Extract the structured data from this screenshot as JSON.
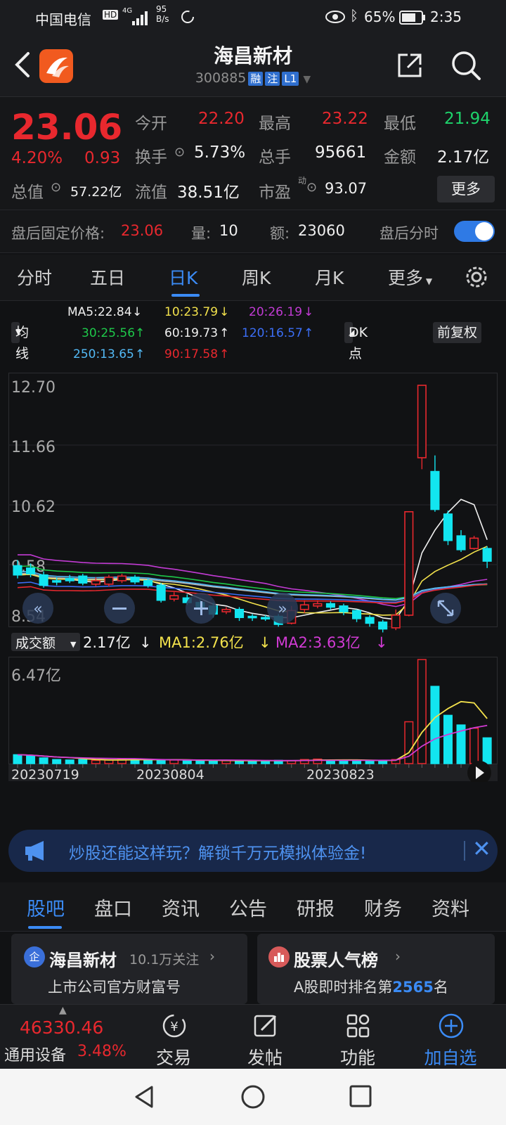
{
  "status": {
    "carrier": "中国电信",
    "network": "4G",
    "speed_value": "95",
    "speed_unit": "B/s",
    "battery": "65%",
    "time": "2:35"
  },
  "header": {
    "title": "海昌新材",
    "code": "300885",
    "tags": [
      "融",
      "注",
      "L1"
    ]
  },
  "quote": {
    "price": "23.06",
    "change_pct": "4.20%",
    "change_amt": "0.93",
    "open_label": "今开",
    "open": "22.20",
    "high_label": "最高",
    "high": "23.22",
    "low_label": "最低",
    "low": "21.94",
    "turnover_label": "换手",
    "turnover": "5.73%",
    "volume_label": "总手",
    "volume": "95661",
    "amount_label": "金额",
    "amount": "2.17亿",
    "mcap_label": "总值",
    "mcap": "57.22亿",
    "float_label": "流值",
    "float": "38.51亿",
    "pe_label": "市盈",
    "pe_sup": "动",
    "pe": "93.07",
    "more_label": "更多",
    "after_label": "盘后固定价格:",
    "after_price": "23.06",
    "after_vol_label": "量:",
    "after_vol": "10",
    "after_amt_label": "额:",
    "after_amt": "23060",
    "after_time_label": "盘后分时"
  },
  "ktabs": [
    "分时",
    "五日",
    "日K",
    "周K",
    "月K",
    "更多"
  ],
  "ma": {
    "ma5": "MA5:22.84",
    "ma10": "10:23.79",
    "ma20": "20:26.19",
    "ma30": "30:25.56",
    "ma60": "60:19.73",
    "ma120": "120:16.57",
    "ma250": "250:13.65",
    "ma90": "90:17.58",
    "avg_btn": "均线",
    "dk_btn": "DK点",
    "adj_btn": "前复权",
    "colors": {
      "ma5": "#f0f0f0",
      "ma10": "#f3e24c",
      "ma20": "#c23bd4",
      "ma30": "#1ec84a",
      "ma60": "#f0f0f0",
      "ma120": "#3b6ef5",
      "ma250": "#53b9f5",
      "ma90": "#e8282e"
    }
  },
  "vol": {
    "label": "成交额",
    "value": "2.17亿",
    "ma1": "MA1:2.76亿",
    "ma2": "MA2:3.63亿",
    "max": "6.47亿"
  },
  "chart_data": {
    "type": "candlestick",
    "y_ticks": [
      "12.70",
      "11.66",
      "10.62",
      "9.58",
      "8.54"
    ],
    "ylim": [
      8.54,
      12.7
    ],
    "x_ticks": [
      "20230719",
      "20230804",
      "20230823"
    ],
    "candles": [
      {
        "o": 9.56,
        "c": 9.4,
        "h": 9.66,
        "l": 9.34
      },
      {
        "o": 9.52,
        "c": 9.42,
        "h": 9.6,
        "l": 9.36
      },
      {
        "o": 9.4,
        "c": 9.22,
        "h": 9.46,
        "l": 9.18
      },
      {
        "o": 9.3,
        "c": 9.28,
        "h": 9.36,
        "l": 9.22
      },
      {
        "o": 9.34,
        "c": 9.3,
        "h": 9.4,
        "l": 9.26
      },
      {
        "o": 9.38,
        "c": 9.26,
        "h": 9.42,
        "l": 9.22
      },
      {
        "o": 9.24,
        "c": 9.3,
        "h": 9.36,
        "l": 9.2
      },
      {
        "o": 9.24,
        "c": 9.36,
        "h": 9.4,
        "l": 9.2
      },
      {
        "o": 9.3,
        "c": 9.38,
        "h": 9.42,
        "l": 9.26
      },
      {
        "o": 9.36,
        "c": 9.28,
        "h": 9.4,
        "l": 9.24
      },
      {
        "o": 9.3,
        "c": 9.22,
        "h": 9.34,
        "l": 9.18
      },
      {
        "o": 9.22,
        "c": 8.96,
        "h": 9.26,
        "l": 8.92
      },
      {
        "o": 8.98,
        "c": 9.04,
        "h": 9.1,
        "l": 8.94
      },
      {
        "o": 9.0,
        "c": 8.92,
        "h": 9.06,
        "l": 8.88
      },
      {
        "o": 8.92,
        "c": 8.82,
        "h": 8.98,
        "l": 8.78
      },
      {
        "o": 8.86,
        "c": 8.72,
        "h": 8.92,
        "l": 8.66
      },
      {
        "o": 8.76,
        "c": 8.8,
        "h": 8.84,
        "l": 8.72
      },
      {
        "o": 8.8,
        "c": 8.66,
        "h": 8.84,
        "l": 8.6
      },
      {
        "o": 8.68,
        "c": 8.66,
        "h": 8.72,
        "l": 8.6
      },
      {
        "o": 8.66,
        "c": 8.64,
        "h": 8.7,
        "l": 8.6
      },
      {
        "o": 8.68,
        "c": 8.54,
        "h": 8.72,
        "l": 8.5
      },
      {
        "o": 8.56,
        "c": 8.78,
        "h": 8.86,
        "l": 8.54
      },
      {
        "o": 8.8,
        "c": 8.88,
        "h": 8.96,
        "l": 8.74
      },
      {
        "o": 8.86,
        "c": 8.9,
        "h": 8.96,
        "l": 8.82
      },
      {
        "o": 8.9,
        "c": 8.84,
        "h": 8.94,
        "l": 8.8
      },
      {
        "o": 8.86,
        "c": 8.76,
        "h": 8.9,
        "l": 8.7
      },
      {
        "o": 8.78,
        "c": 8.64,
        "h": 8.8,
        "l": 8.58
      },
      {
        "o": 8.66,
        "c": 8.56,
        "h": 8.7,
        "l": 8.5
      },
      {
        "o": 8.58,
        "c": 8.46,
        "h": 8.62,
        "l": 8.4
      },
      {
        "o": 8.48,
        "c": 8.7,
        "h": 8.8,
        "l": 8.44
      },
      {
        "o": 8.7,
        "c": 10.5,
        "h": 10.5,
        "l": 8.68
      },
      {
        "o": 11.44,
        "c": 12.7,
        "h": 12.7,
        "l": 11.24
      },
      {
        "o": 11.2,
        "c": 10.54,
        "h": 11.48,
        "l": 10.5
      },
      {
        "o": 10.46,
        "c": 10.0,
        "h": 10.52,
        "l": 9.92
      },
      {
        "o": 10.08,
        "c": 9.84,
        "h": 10.18,
        "l": 9.8
      },
      {
        "o": 9.86,
        "c": 10.04,
        "h": 10.08,
        "l": 9.84
      },
      {
        "o": 9.86,
        "c": 9.64,
        "h": 9.9,
        "l": 9.52
      }
    ],
    "volumes": [
      0.55,
      0.5,
      0.35,
      0.25,
      0.22,
      0.25,
      0.2,
      0.22,
      0.25,
      0.28,
      0.25,
      0.2,
      0.22,
      0.2,
      0.18,
      0.2,
      0.18,
      0.18,
      0.16,
      0.18,
      0.2,
      0.18,
      0.25,
      0.28,
      0.2,
      0.22,
      0.18,
      0.18,
      0.2,
      0.25,
      2.6,
      6.47,
      4.8,
      3.0,
      2.4,
      2.2,
      1.6
    ]
  },
  "banner": {
    "text": "炒股还能这样玩？解锁千万元模拟体验金!"
  },
  "ltabs": [
    "股吧",
    "盘口",
    "资讯",
    "公告",
    "研报",
    "财务",
    "资料"
  ],
  "cards": {
    "left_title": "海昌新材",
    "left_follow": "10.1万关注",
    "left_sub": "上市公司官方财富号",
    "right_title": "股票人气榜",
    "right_sub_pre": "A股即时排名第",
    "right_rank": "2565",
    "right_sub_post": "名"
  },
  "bottom": {
    "index_value": "46330.46",
    "index_name": "通用设备",
    "index_pct": "3.48%",
    "trade": "交易",
    "post": "发帖",
    "func": "功能",
    "add": "加自选"
  }
}
